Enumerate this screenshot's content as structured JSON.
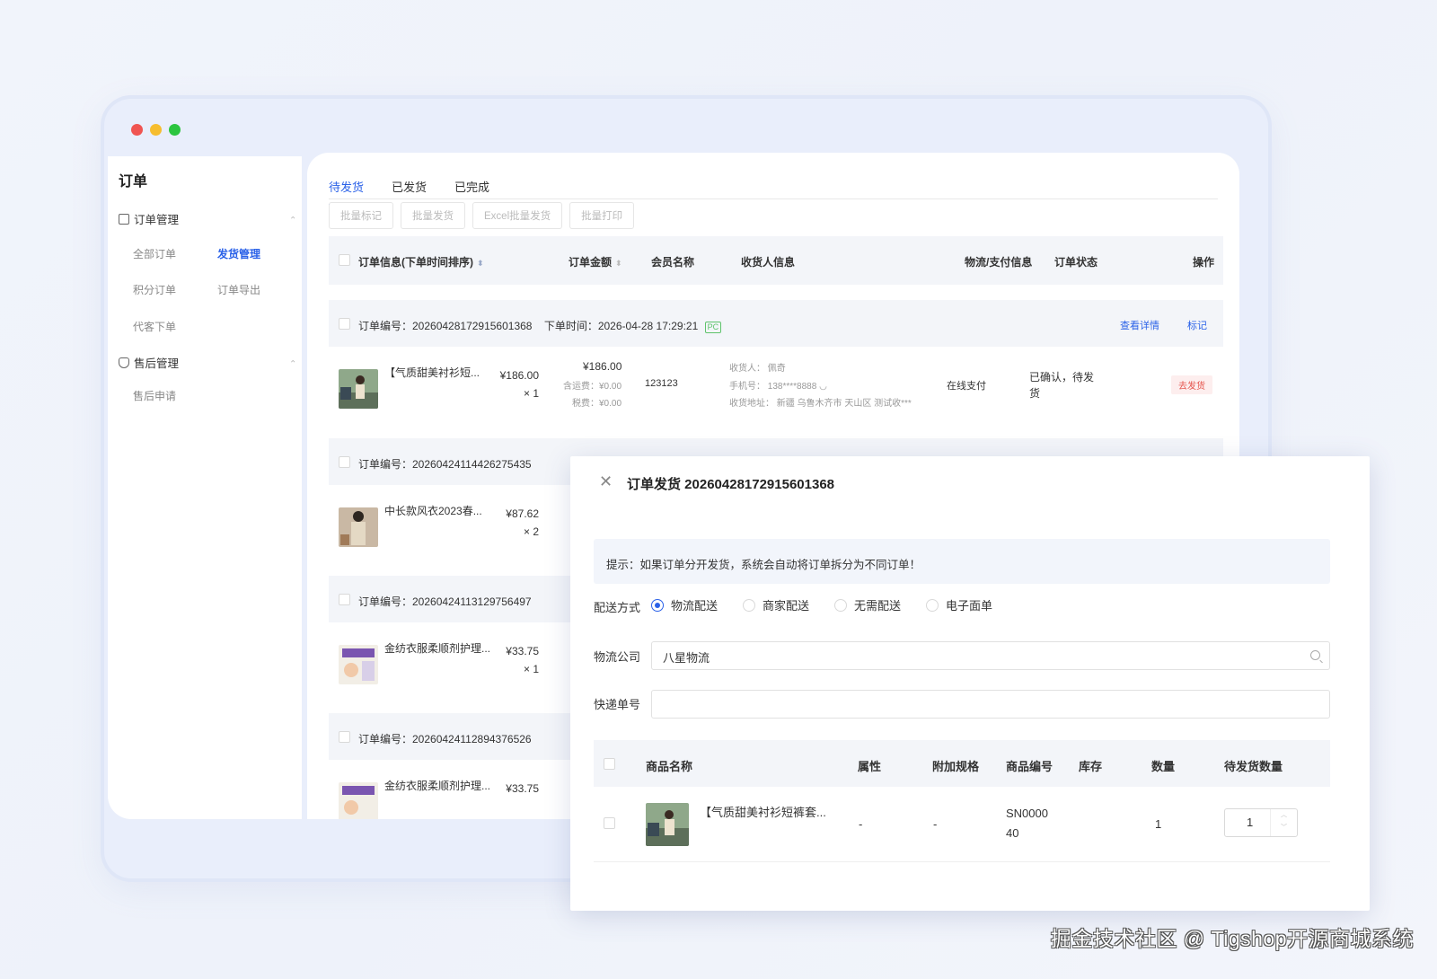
{
  "sidebar": {
    "title": "订单",
    "groups": [
      {
        "label": "订单管理",
        "items": [
          "全部订单",
          "发货管理",
          "积分订单",
          "订单导出",
          "代客下单"
        ]
      },
      {
        "label": "售后管理",
        "items": [
          "售后申请"
        ]
      }
    ]
  },
  "tabs": [
    "待发货",
    "已发货",
    "已完成"
  ],
  "actions": [
    "批量标记",
    "批量发货",
    "Excel批量发货",
    "批量打印"
  ],
  "table": {
    "headers": [
      "订单信息(下单时间排序)",
      "订单金额",
      "会员名称",
      "收货人信息",
      "物流/支付信息",
      "订单状态",
      "操作"
    ]
  },
  "orders": [
    {
      "no": "订单编号：20260428172915601368",
      "time": "下单时间：2026-04-28 17:29:21",
      "tag": "PC",
      "view": "查看详情",
      "mark": "标记",
      "product": "【气质甜美衬衫短...",
      "price": "¥186.00",
      "qty": "× 1",
      "total": "¥186.00",
      "shipping_fee": "含运费：¥0.00",
      "tax": "税费：¥0.00",
      "member": "123123",
      "receiver": "收货人：  佩奇",
      "phone": "手机号：  138****8888",
      "address": "收货地址：  新疆 乌鲁木齐市 天山区 测试收***",
      "pay": "在线支付",
      "status": "已确认，待发货",
      "ship_btn": "去发货"
    },
    {
      "no": "订单编号：20260424114426275435",
      "product": "中长款风衣2023春...",
      "price": "¥87.62",
      "qty": "× 2"
    },
    {
      "no": "订单编号：20260424113129756497",
      "product": "金纺衣服柔顺剂护理...",
      "price": "¥33.75",
      "qty": "× 1"
    },
    {
      "no": "订单编号：20260424112894376526",
      "product": "金纺衣服柔顺剂护理...",
      "price": "¥33.75",
      "qty": ""
    }
  ],
  "dialog": {
    "title": "订单发货 20260428172915601368",
    "tip": "提示：如果订单分开发货，系统会自动将订单拆分为不同订单！",
    "delivery_label": "配送方式",
    "delivery_options": [
      "物流配送",
      "商家配送",
      "无需配送",
      "电子面单"
    ],
    "delivery_selected": "物流配送",
    "company_label": "物流公司",
    "company_value": "八星物流",
    "tracking_label": "快递单号",
    "tracking_value": "",
    "goods_headers": [
      "商品名称",
      "属性",
      "附加规格",
      "商品编号",
      "库存",
      "数量",
      "待发货数量"
    ],
    "goods_row": {
      "name": "【气质甜美衬衫短裤套...",
      "attr": "-",
      "extra": "-",
      "sn1": "SN0000",
      "sn2": "40",
      "stock": "",
      "qty": "1",
      "pending": "1"
    }
  },
  "watermark": "掘金技术社区 @ Tigshop开源商城系统",
  "colors": {
    "accent": "#2b62e8",
    "danger": "#e5534b",
    "success": "#5ec36b"
  }
}
